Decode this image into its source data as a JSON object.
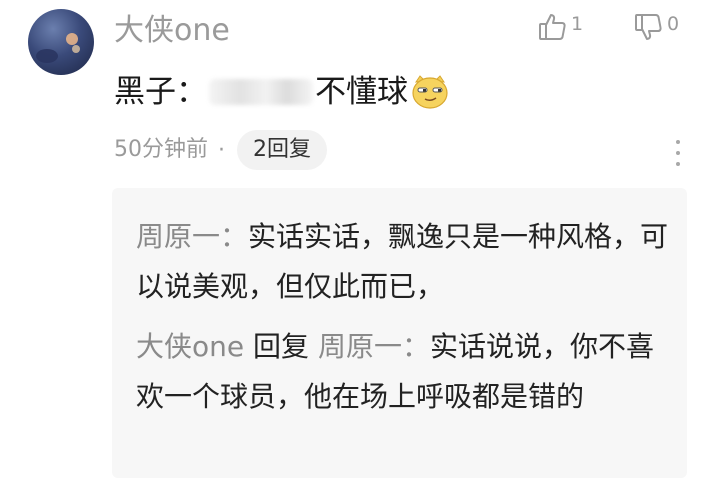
{
  "comment": {
    "username": "大侠one",
    "text_prefix": "黑子：",
    "text_suffix": "不懂球",
    "emoji": "smirk-face-emoji",
    "time": "50分钟前",
    "separator": "·",
    "reply_count_label": "2回复"
  },
  "votes": {
    "like_count": "1",
    "dislike_count": "0"
  },
  "replies": [
    {
      "author": "周原一",
      "sep": "：",
      "content": "实话实话，飘逸只是一种风格，可以说美观，但仅此而已，"
    },
    {
      "author": "大侠one",
      "reply_word": "回复",
      "target": "周原一",
      "sep": "：",
      "content": "实话说说，你不喜欢一个球员，他在场上呼吸都是错的"
    }
  ],
  "colors": {
    "muted": "#9a9a9a",
    "text": "#1a1a1a",
    "reply_bg": "#f7f7f7",
    "pill_bg": "#f2f2f2"
  }
}
